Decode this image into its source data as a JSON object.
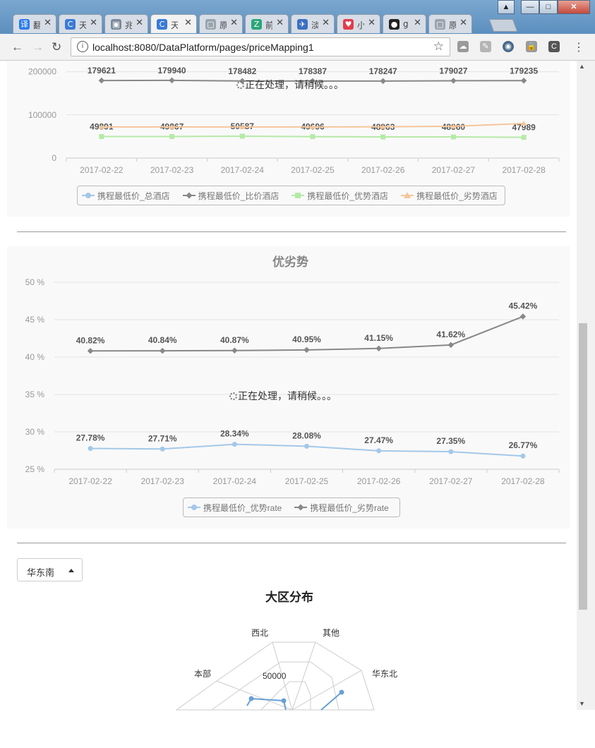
{
  "browser": {
    "tabs": [
      {
        "icon": "translate-icon",
        "color": "#2b7ce9",
        "glyph": "译",
        "label": "翻"
      },
      {
        "icon": "ctrip-icon",
        "color": "#3a7bd5",
        "glyph": "C",
        "label": "天"
      },
      {
        "icon": "doc-image-icon",
        "color": "#7d8a99",
        "glyph": "▣",
        "label": "兆"
      },
      {
        "icon": "ctrip-icon",
        "color": "#3a7bd5",
        "glyph": "C",
        "label": "天",
        "active": true
      },
      {
        "icon": "page-icon",
        "color": "#9aa4ae",
        "glyph": "▢",
        "label": "原"
      },
      {
        "icon": "zhihu-icon",
        "color": "#2aa67a",
        "glyph": "Z",
        "label": "前"
      },
      {
        "icon": "bird-icon",
        "color": "#3b6fc1",
        "glyph": "✈",
        "label": "淡"
      },
      {
        "icon": "heart-icon",
        "color": "#e23d4b",
        "glyph": "♥",
        "label": "小"
      },
      {
        "icon": "github-icon",
        "color": "#222222",
        "glyph": "●",
        "label": "g"
      },
      {
        "icon": "page-icon",
        "color": "#9aa4ae",
        "glyph": "▢",
        "label": "原"
      }
    ],
    "close_glyph": "✕",
    "url": "localhost:8080/DataPlatform/pages/priceMapping1",
    "window_buttons": [
      "▲",
      "—",
      "□",
      "✕"
    ]
  },
  "chart1": {
    "yticks": [
      "200000",
      "100000",
      "0"
    ],
    "legend": [
      "携程最低价_总酒店",
      "携程最低价_比价酒店",
      "携程最低价_优势酒店",
      "携程最低价_劣势酒店"
    ],
    "loading_text": "正在处理，请稍候。。。"
  },
  "chart2": {
    "title": "优劣势",
    "yticks": [
      "50 %",
      "45 %",
      "40 %",
      "35 %",
      "30 %",
      "25 %"
    ],
    "legend": [
      "携程最低价_优势rate",
      "携程最低价_劣势rate"
    ],
    "loading_text": "正在处理，请稍候。。。"
  },
  "region": {
    "dropdown_value": "华东南",
    "title": "大区分布",
    "radar_labels": [
      "西北",
      "其他",
      "本部",
      "华东北"
    ],
    "radar_tick": "50000"
  },
  "chart_data": [
    {
      "type": "line",
      "title": "",
      "categories": [
        "2017-02-22",
        "2017-02-23",
        "2017-02-24",
        "2017-02-25",
        "2017-02-26",
        "2017-02-27",
        "2017-02-28"
      ],
      "ylim": [
        0,
        250000
      ],
      "series": [
        {
          "name": "携程最低价_总酒店",
          "color": "#a3c8e8",
          "labels": false,
          "values": [
            null,
            null,
            null,
            null,
            null,
            null,
            null
          ]
        },
        {
          "name": "携程最低价_比价酒店",
          "color": "#888888",
          "labels": true,
          "values": [
            179621,
            179940,
            178482,
            178387,
            178247,
            179027,
            179235
          ]
        },
        {
          "name": "携程最低价_优势酒店",
          "color": "#b5eaa7",
          "labels": true,
          "values": [
            49891,
            49867,
            50587,
            49696,
            48963,
            48960,
            47989
          ]
        },
        {
          "name": "携程最低价_劣势酒店",
          "color": "#f5c69a",
          "labels": false,
          "values": [
            72000,
            72000,
            72000,
            72000,
            72500,
            73500,
            80000
          ]
        }
      ]
    },
    {
      "type": "line",
      "title": "优劣势",
      "categories": [
        "2017-02-22",
        "2017-02-23",
        "2017-02-24",
        "2017-02-25",
        "2017-02-26",
        "2017-02-27",
        "2017-02-28"
      ],
      "ylim": [
        25,
        50
      ],
      "unit": "%",
      "series": [
        {
          "name": "携程最低价_优势rate",
          "color": "#a3c8e8",
          "values": [
            27.78,
            27.71,
            28.34,
            28.08,
            27.47,
            27.35,
            26.77
          ]
        },
        {
          "name": "携程最低价_劣势rate",
          "color": "#888888",
          "values": [
            40.82,
            40.84,
            40.87,
            40.95,
            41.15,
            41.62,
            45.42
          ]
        }
      ]
    }
  ]
}
